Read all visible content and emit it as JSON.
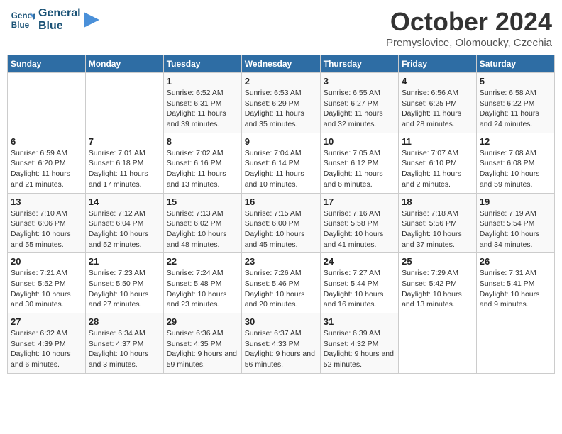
{
  "header": {
    "logo_line1": "General",
    "logo_line2": "Blue",
    "month": "October 2024",
    "location": "Premyslovice, Olomoucky, Czechia"
  },
  "days_of_week": [
    "Sunday",
    "Monday",
    "Tuesday",
    "Wednesday",
    "Thursday",
    "Friday",
    "Saturday"
  ],
  "weeks": [
    [
      {
        "day": "",
        "info": ""
      },
      {
        "day": "",
        "info": ""
      },
      {
        "day": "1",
        "info": "Sunrise: 6:52 AM\nSunset: 6:31 PM\nDaylight: 11 hours and 39 minutes."
      },
      {
        "day": "2",
        "info": "Sunrise: 6:53 AM\nSunset: 6:29 PM\nDaylight: 11 hours and 35 minutes."
      },
      {
        "day": "3",
        "info": "Sunrise: 6:55 AM\nSunset: 6:27 PM\nDaylight: 11 hours and 32 minutes."
      },
      {
        "day": "4",
        "info": "Sunrise: 6:56 AM\nSunset: 6:25 PM\nDaylight: 11 hours and 28 minutes."
      },
      {
        "day": "5",
        "info": "Sunrise: 6:58 AM\nSunset: 6:22 PM\nDaylight: 11 hours and 24 minutes."
      }
    ],
    [
      {
        "day": "6",
        "info": "Sunrise: 6:59 AM\nSunset: 6:20 PM\nDaylight: 11 hours and 21 minutes."
      },
      {
        "day": "7",
        "info": "Sunrise: 7:01 AM\nSunset: 6:18 PM\nDaylight: 11 hours and 17 minutes."
      },
      {
        "day": "8",
        "info": "Sunrise: 7:02 AM\nSunset: 6:16 PM\nDaylight: 11 hours and 13 minutes."
      },
      {
        "day": "9",
        "info": "Sunrise: 7:04 AM\nSunset: 6:14 PM\nDaylight: 11 hours and 10 minutes."
      },
      {
        "day": "10",
        "info": "Sunrise: 7:05 AM\nSunset: 6:12 PM\nDaylight: 11 hours and 6 minutes."
      },
      {
        "day": "11",
        "info": "Sunrise: 7:07 AM\nSunset: 6:10 PM\nDaylight: 11 hours and 2 minutes."
      },
      {
        "day": "12",
        "info": "Sunrise: 7:08 AM\nSunset: 6:08 PM\nDaylight: 10 hours and 59 minutes."
      }
    ],
    [
      {
        "day": "13",
        "info": "Sunrise: 7:10 AM\nSunset: 6:06 PM\nDaylight: 10 hours and 55 minutes."
      },
      {
        "day": "14",
        "info": "Sunrise: 7:12 AM\nSunset: 6:04 PM\nDaylight: 10 hours and 52 minutes."
      },
      {
        "day": "15",
        "info": "Sunrise: 7:13 AM\nSunset: 6:02 PM\nDaylight: 10 hours and 48 minutes."
      },
      {
        "day": "16",
        "info": "Sunrise: 7:15 AM\nSunset: 6:00 PM\nDaylight: 10 hours and 45 minutes."
      },
      {
        "day": "17",
        "info": "Sunrise: 7:16 AM\nSunset: 5:58 PM\nDaylight: 10 hours and 41 minutes."
      },
      {
        "day": "18",
        "info": "Sunrise: 7:18 AM\nSunset: 5:56 PM\nDaylight: 10 hours and 37 minutes."
      },
      {
        "day": "19",
        "info": "Sunrise: 7:19 AM\nSunset: 5:54 PM\nDaylight: 10 hours and 34 minutes."
      }
    ],
    [
      {
        "day": "20",
        "info": "Sunrise: 7:21 AM\nSunset: 5:52 PM\nDaylight: 10 hours and 30 minutes."
      },
      {
        "day": "21",
        "info": "Sunrise: 7:23 AM\nSunset: 5:50 PM\nDaylight: 10 hours and 27 minutes."
      },
      {
        "day": "22",
        "info": "Sunrise: 7:24 AM\nSunset: 5:48 PM\nDaylight: 10 hours and 23 minutes."
      },
      {
        "day": "23",
        "info": "Sunrise: 7:26 AM\nSunset: 5:46 PM\nDaylight: 10 hours and 20 minutes."
      },
      {
        "day": "24",
        "info": "Sunrise: 7:27 AM\nSunset: 5:44 PM\nDaylight: 10 hours and 16 minutes."
      },
      {
        "day": "25",
        "info": "Sunrise: 7:29 AM\nSunset: 5:42 PM\nDaylight: 10 hours and 13 minutes."
      },
      {
        "day": "26",
        "info": "Sunrise: 7:31 AM\nSunset: 5:41 PM\nDaylight: 10 hours and 9 minutes."
      }
    ],
    [
      {
        "day": "27",
        "info": "Sunrise: 6:32 AM\nSunset: 4:39 PM\nDaylight: 10 hours and 6 minutes."
      },
      {
        "day": "28",
        "info": "Sunrise: 6:34 AM\nSunset: 4:37 PM\nDaylight: 10 hours and 3 minutes."
      },
      {
        "day": "29",
        "info": "Sunrise: 6:36 AM\nSunset: 4:35 PM\nDaylight: 9 hours and 59 minutes."
      },
      {
        "day": "30",
        "info": "Sunrise: 6:37 AM\nSunset: 4:33 PM\nDaylight: 9 hours and 56 minutes."
      },
      {
        "day": "31",
        "info": "Sunrise: 6:39 AM\nSunset: 4:32 PM\nDaylight: 9 hours and 52 minutes."
      },
      {
        "day": "",
        "info": ""
      },
      {
        "day": "",
        "info": ""
      }
    ]
  ]
}
